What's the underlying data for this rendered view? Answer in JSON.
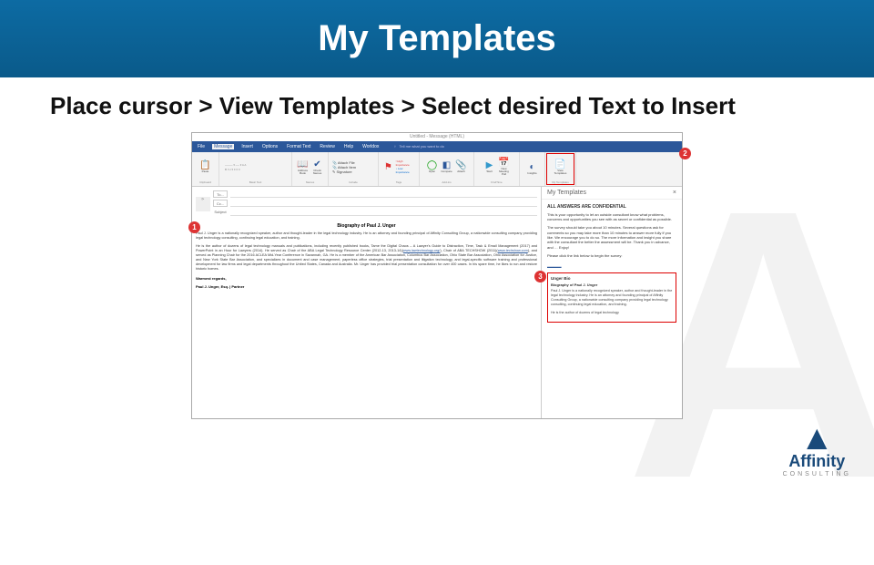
{
  "slide": {
    "title": "My Templates",
    "instruction": "Place cursor > View Templates > Select desired Text to Insert"
  },
  "outlook": {
    "window_title": "Untitled - Message (HTML)",
    "tabs": {
      "file": "File",
      "message": "Message",
      "insert": "Insert",
      "options": "Options",
      "format": "Format Text",
      "review": "Review",
      "help": "Help",
      "worldox": "Worldox",
      "tell": "Tell me what you want to do"
    },
    "ribbon": {
      "clipboard": {
        "label": "Clipboard",
        "paste": "Paste"
      },
      "basic_text": {
        "label": "Basic Text"
      },
      "names": {
        "label": "Names",
        "address": "Address Book",
        "check": "Check Names"
      },
      "include": {
        "label": "Include",
        "attach_file": "Attach File",
        "attach_item": "Attach Item",
        "signature": "Signature"
      },
      "tags": {
        "label": "Tags",
        "follow": "Follow Up",
        "high": "High Importance",
        "low": "Low Importance"
      },
      "addins": {
        "label": "Add-ins",
        "open": "Open",
        "compare": "Compare",
        "attach": "Attach"
      },
      "findtime": {
        "label": "FindTime",
        "start": "Start",
        "new": "New Meeting Poll"
      },
      "insights": {
        "label": "",
        "btn": "Insights"
      },
      "mytemplates": {
        "label": "My Templates",
        "view": "View Templates"
      }
    },
    "compose": {
      "to": "To...",
      "cc": "Cc...",
      "subject": "Subject",
      "doc_title": "Biography of Paul J. Unger",
      "p1": "Paul J. Unger is a nationally recognized speaker, author and thought-leader in the legal technology industry. He is an attorney and founding principal of Affinity Consulting Group, a nationwide consulting company providing legal technology consulting, continuing legal education, and training.",
      "p2_a": "He is the author of dozens of legal technology manuals and publications, including recently published books, Tame the Digital Chaos – A Lawyer's Guide to Distraction, Time, Task & Email Management (2017) and PowerPoint in an Hour for Lawyers (2014). He served as Chair of the ABA Legal Technology Resource Center (2012-13, 2013-14)(",
      "p2_link1": "www.lawtechnology.org/",
      "p2_b": "), Chair of ABA TECHSHOW (2011)(",
      "p2_link2": "www.techshow.com",
      "p2_c": "), and served as Planning Chair for the 2016 ACLEA Mid-Year Conference in Savannah, GA. He is a member of the American Bar Association, Columbus Bar Association, Ohio State Bar Association, Ohio Association for Justice, and New York State Bar Association, and specializes in document and case management, paperless office strategies, trial presentation and litigation technology, and legal-specific software training and professional development for law firms and legal departments throughout the United States, Canada and Australia. Mr. Unger has provided trial presentation consultation for over 400 cases. In his spare time, he likes to run and restore historic homes.",
      "sign1": "Warmest regards,",
      "sign2": "Paul J. Unger, Esq. | Partner"
    },
    "pane": {
      "title": "My Templates",
      "close": "×",
      "h": "ALL ANSWERS ARE CONFIDENTIAL",
      "p1": "This is your opportunity to let an outside consultant know what problems, concerns and opportunities you see with as secret or confidential as possible.",
      "p2": "The survey should take you about 10 minutes. Several questions ask for comments so you may take more than 10 minutes to answer more fully if you like. We encourage you to do so. The more information and insight you share with the consultant the better the assessment will be. Thank you in advance, and … Enjoy!",
      "p3": "Please click the link below to begin the survey:",
      "card_title": "Unger Bio",
      "card_sub": "Biography of Paul J. Unger",
      "card_body": "Paul J. Unger is a nationally recognized speaker, author and thought-leader in the legal technology industry. He is an attorney and founding principal of Affinity Consulting Group, a nationwide consulting company providing legal technology consulting, continuing legal education, and training.",
      "card_more": "He is the author of dozens of legal technology"
    }
  },
  "callouts": {
    "c1": "1",
    "c2": "2",
    "c3": "3"
  },
  "logo": {
    "word": "Affinity",
    "sub": "CONSULTING"
  }
}
